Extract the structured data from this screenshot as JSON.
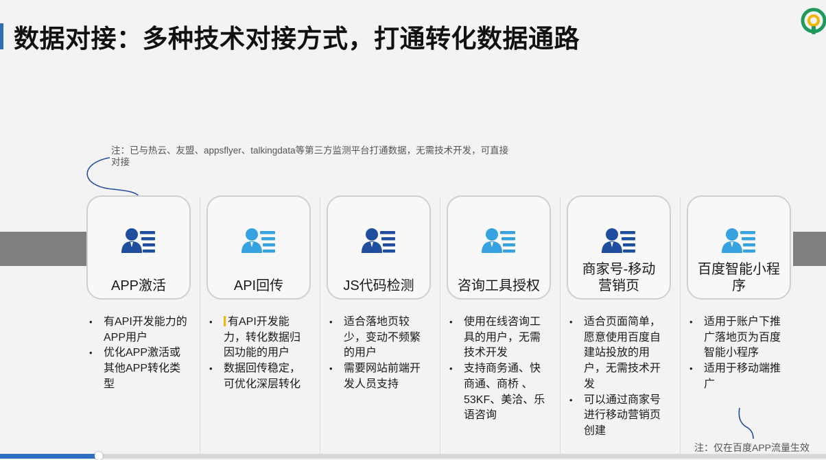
{
  "slide": {
    "title": "数据对接：多种技术对接方式，打通转化数据通路",
    "top_note": "注：已与热云、友盟、appsflyer、talkingdata等第三方监测平台打通数据，无需技术开发，可直接对接",
    "bottom_note": "注：仅在百度APP流量生效",
    "accent_color": "#2f6db5",
    "icon_name": "user-list-icon"
  },
  "cards": [
    {
      "label": "APP激活",
      "icon_color": "#1f4e9e",
      "bullets": [
        "有API开发能力的APP用户",
        "优化APP激活或其他APP转化类型"
      ]
    },
    {
      "label": "API回传",
      "icon_color": "#36a3e0",
      "bullets": [
        "有API开发能力，转化数据归因功能的用户",
        "数据回传稳定，可优化深层转化"
      ]
    },
    {
      "label": "JS代码检测",
      "icon_color": "#1f4e9e",
      "bullets": [
        "适合落地页较少，变动不频繁的用户",
        "需要网站前端开发人员支持"
      ]
    },
    {
      "label": "咨询工具授权",
      "icon_color": "#36a3e0",
      "bullets": [
        "使用在线咨询工具的用户，无需技术开发",
        "支持商务通、快商通、商桥 、53KF、美洽、乐语咨询"
      ]
    },
    {
      "label": "商家号-移动营销页",
      "icon_color": "#1f4e9e",
      "bullets": [
        "适合页面简单，愿意使用百度自建站投放的用户，无需技术开发",
        "可以通过商家号进行移动营销页创建"
      ]
    },
    {
      "label": "百度智能小程序",
      "icon_color": "#36a3e0",
      "bullets": [
        "适用于账户下推广落地页为百度智能小程序",
        "适用于移动端推广"
      ]
    }
  ],
  "player": {
    "progress": 0.12
  }
}
